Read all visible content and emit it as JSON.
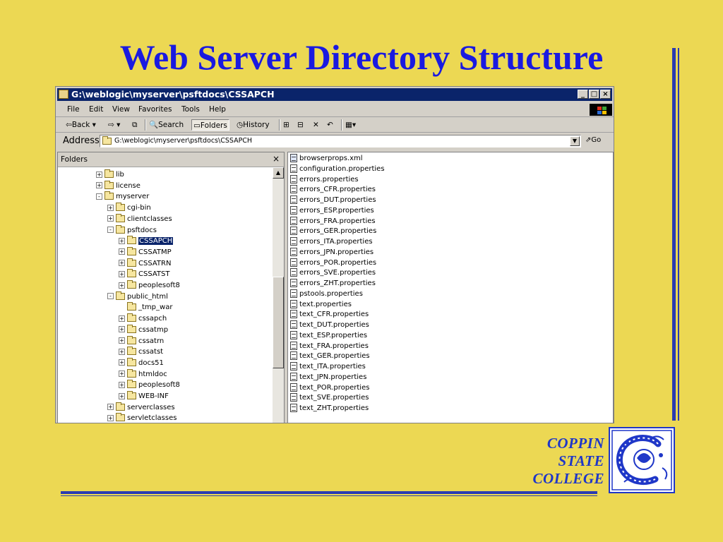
{
  "slide": {
    "title": "Web Server Directory Structure",
    "logo_text": [
      "COPPIN",
      "STATE",
      "COLLEGE"
    ]
  },
  "window": {
    "title": "G:\\weblogic\\myserver\\psftdocs\\CSSAPCH",
    "controls": [
      "_",
      "□",
      "×"
    ],
    "menu": [
      "File",
      "Edit",
      "View",
      "Favorites",
      "Tools",
      "Help"
    ],
    "toolbar": {
      "back": "Back",
      "search": "Search",
      "folders": "Folders",
      "history": "History"
    },
    "address": {
      "label": "Address",
      "value": "G:\\weblogic\\myserver\\psftdocs\\CSSAPCH",
      "go": "Go"
    },
    "folders_pane": {
      "header": "Folders",
      "close": "×",
      "tree": [
        {
          "label": "lib",
          "depth": 3,
          "expander": "+"
        },
        {
          "label": "license",
          "depth": 3,
          "expander": "+"
        },
        {
          "label": "myserver",
          "depth": 3,
          "expander": "-"
        },
        {
          "label": "cgi-bin",
          "depth": 4,
          "expander": "+"
        },
        {
          "label": "clientclasses",
          "depth": 4,
          "expander": "+"
        },
        {
          "label": "psftdocs",
          "depth": 4,
          "expander": "-"
        },
        {
          "label": "CSSAPCH",
          "depth": 5,
          "expander": "+",
          "selected": true
        },
        {
          "label": "CSSATMP",
          "depth": 5,
          "expander": "+"
        },
        {
          "label": "CSSATRN",
          "depth": 5,
          "expander": "+"
        },
        {
          "label": "CSSATST",
          "depth": 5,
          "expander": "+"
        },
        {
          "label": "peoplesoft8",
          "depth": 5,
          "expander": "+"
        },
        {
          "label": "public_html",
          "depth": 4,
          "expander": "-"
        },
        {
          "label": "_tmp_war",
          "depth": 5,
          "expander": ""
        },
        {
          "label": "cssapch",
          "depth": 5,
          "expander": "+"
        },
        {
          "label": "cssatmp",
          "depth": 5,
          "expander": "+"
        },
        {
          "label": "cssatrn",
          "depth": 5,
          "expander": "+"
        },
        {
          "label": "cssatst",
          "depth": 5,
          "expander": "+"
        },
        {
          "label": "docs51",
          "depth": 5,
          "expander": "+"
        },
        {
          "label": "htmldoc",
          "depth": 5,
          "expander": "+"
        },
        {
          "label": "peoplesoft8",
          "depth": 5,
          "expander": "+"
        },
        {
          "label": "WEB-INF",
          "depth": 5,
          "expander": "+"
        },
        {
          "label": "serverclasses",
          "depth": 4,
          "expander": "+"
        },
        {
          "label": "servletclasses",
          "depth": 4,
          "expander": "+"
        }
      ]
    },
    "files": [
      {
        "name": "browserprops.xml",
        "icon": "xml-file-icon"
      },
      {
        "name": "configuration.properties",
        "icon": "text-file-icon"
      },
      {
        "name": "errors.properties",
        "icon": "text-file-icon"
      },
      {
        "name": "errors_CFR.properties",
        "icon": "text-file-icon"
      },
      {
        "name": "errors_DUT.properties",
        "icon": "text-file-icon"
      },
      {
        "name": "errors_ESP.properties",
        "icon": "text-file-icon"
      },
      {
        "name": "errors_FRA.properties",
        "icon": "text-file-icon"
      },
      {
        "name": "errors_GER.properties",
        "icon": "text-file-icon"
      },
      {
        "name": "errors_ITA.properties",
        "icon": "text-file-icon"
      },
      {
        "name": "errors_JPN.properties",
        "icon": "text-file-icon"
      },
      {
        "name": "errors_POR.properties",
        "icon": "text-file-icon"
      },
      {
        "name": "errors_SVE.properties",
        "icon": "text-file-icon"
      },
      {
        "name": "errors_ZHT.properties",
        "icon": "text-file-icon"
      },
      {
        "name": "pstools.properties",
        "icon": "text-file-icon"
      },
      {
        "name": "text.properties",
        "icon": "text-file-icon"
      },
      {
        "name": "text_CFR.properties",
        "icon": "text-file-icon"
      },
      {
        "name": "text_DUT.properties",
        "icon": "text-file-icon"
      },
      {
        "name": "text_ESP.properties",
        "icon": "text-file-icon"
      },
      {
        "name": "text_FRA.properties",
        "icon": "text-file-icon"
      },
      {
        "name": "text_GER.properties",
        "icon": "text-file-icon"
      },
      {
        "name": "text_ITA.properties",
        "icon": "text-file-icon"
      },
      {
        "name": "text_JPN.properties",
        "icon": "text-file-icon"
      },
      {
        "name": "text_POR.properties",
        "icon": "text-file-icon"
      },
      {
        "name": "text_SVE.properties",
        "icon": "text-file-icon"
      },
      {
        "name": "text_ZHT.properties",
        "icon": "text-file-icon"
      }
    ]
  },
  "colors": {
    "slide_background": "#ECD853",
    "title": "#1A1AE0",
    "accent_bars": "#2B3BB0",
    "logo": "#1F37C8",
    "selection": "#0A246A"
  }
}
